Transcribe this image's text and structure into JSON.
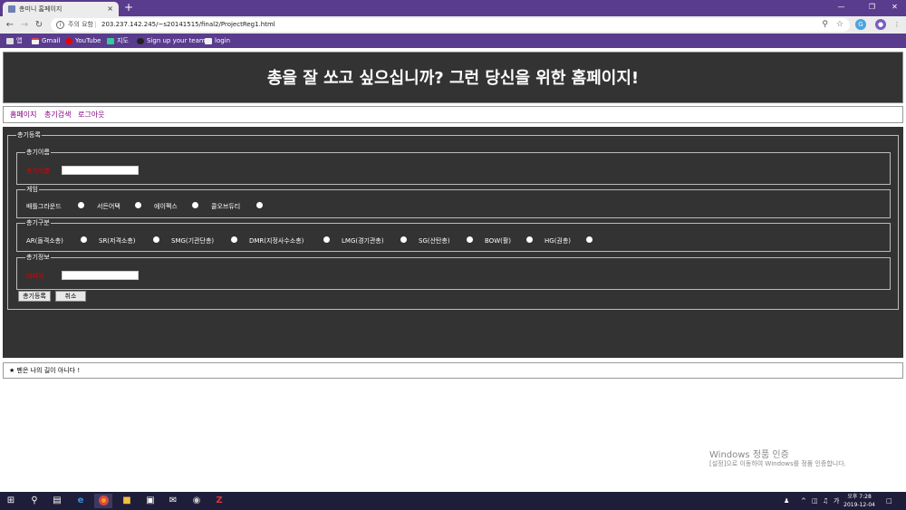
{
  "browser": {
    "tab_title": "총미니 홈페이지",
    "tab_close": "×",
    "new_tab": "+",
    "security_label": "주의 요함",
    "url": "203.237.142.245/~s20141515/final2/ProjectReg1.html",
    "bookmarks": [
      "앱",
      "Gmail",
      "YouTube",
      "지도",
      "Sign up your team",
      "login"
    ]
  },
  "header": {
    "title": "총을 잘 쏘고 싶으십니까? 그런 당신을 위한 홈페이지!"
  },
  "nav": {
    "items": [
      "홈페이지",
      "총기검색",
      "로그아웃"
    ]
  },
  "form": {
    "legend": "총기등록",
    "name_section": {
      "legend": "총기이름",
      "label": "총기이름",
      "value": ""
    },
    "game_section": {
      "legend": "게임",
      "options": [
        "배틀그라운드",
        "서든어택",
        "에이펙스",
        "콜오브듀티"
      ]
    },
    "type_section": {
      "legend": "총기구분",
      "options": [
        "AR(돌격소총)",
        "SR(저격소총)",
        "SMG(기관단총)",
        "DMR(지정사수소총)",
        "LMG(경기관총)",
        "SG(산탄총)",
        "BOW(활)",
        "HG(권총)"
      ]
    },
    "info_section": {
      "legend": "총기정보",
      "label": "데미지",
      "value": ""
    },
    "submit_label": "총기등록",
    "cancel_label": "취소"
  },
  "footer": {
    "text": "★ 펜은 나의 길이 아니다 !"
  },
  "watermark": {
    "line1": "Windows 정품 인증",
    "line2": "[설정]으로 이동하여 Windows를 정품 인증합니다."
  },
  "taskbar": {
    "time": "오후 7:28",
    "date": "2019-12-04",
    "ime": "가"
  },
  "colors": {
    "tabbar": "#5a3c8e",
    "page_dark": "#333333",
    "label_red": "#dd0000",
    "link_purple": "#800080"
  }
}
